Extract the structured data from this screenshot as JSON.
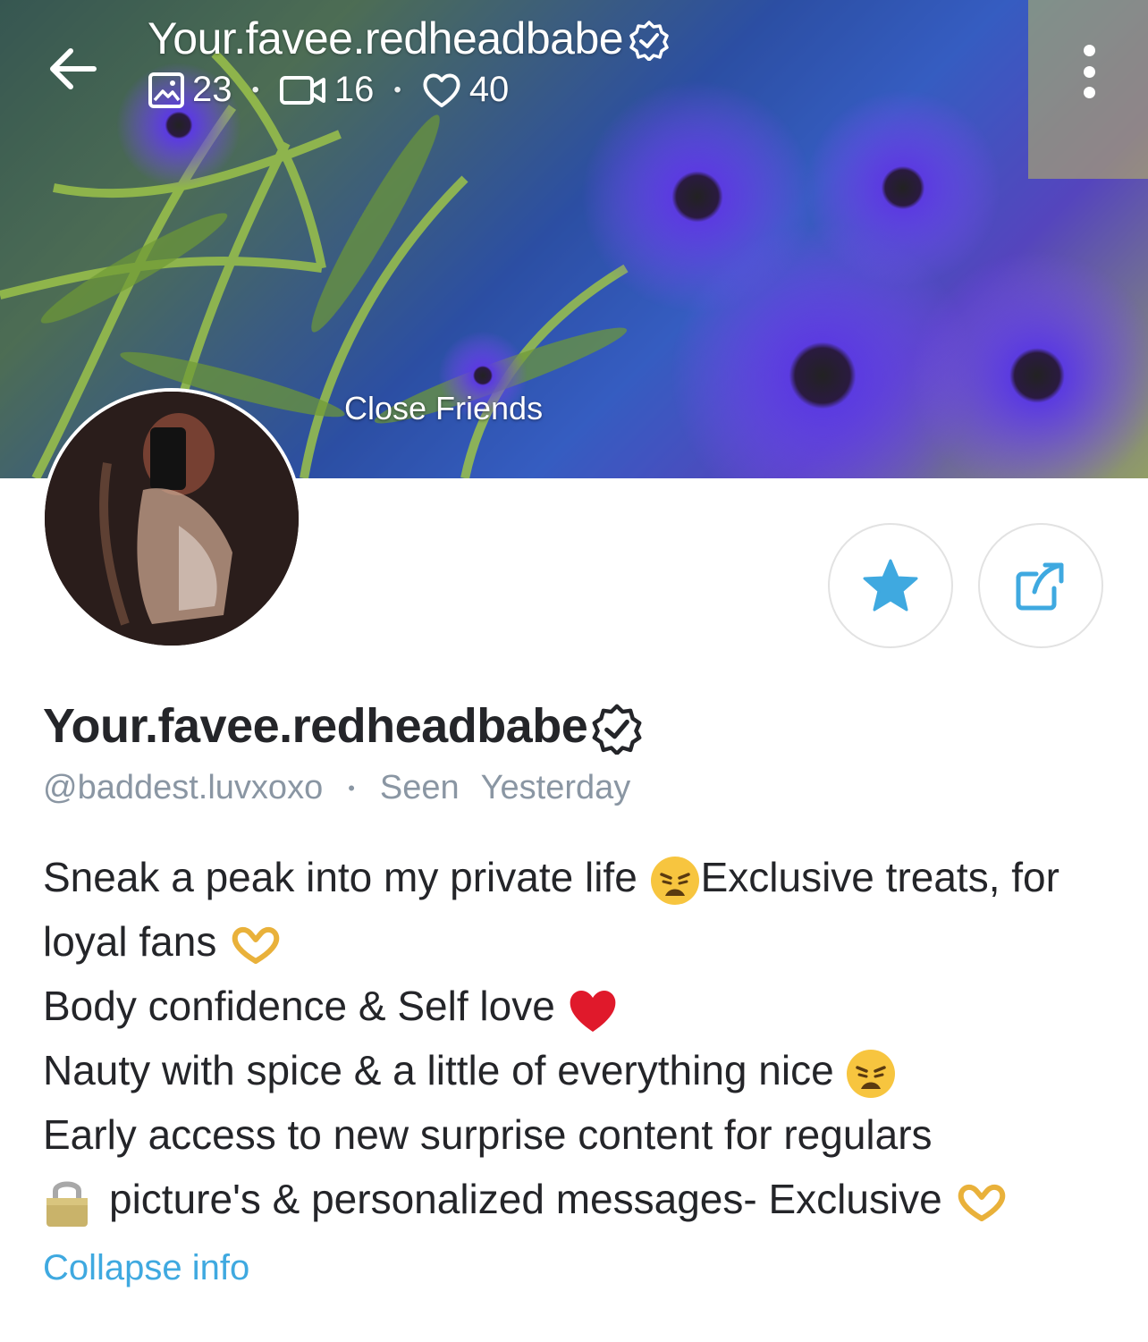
{
  "header": {
    "title": "Your.favee.redheadbabe",
    "stats": {
      "photos": "23",
      "videos": "16",
      "likes": "40"
    },
    "cover_label": "Close Friends"
  },
  "profile": {
    "name": "Your.favee.redheadbabe",
    "handle": "@baddest.luvxoxo",
    "seen_label": "Seen",
    "seen_value": "Yesterday"
  },
  "bio": {
    "line1_a": "Sneak a peak into my private life ",
    "line1_b": "Exclusive treats, for",
    "line2": "loyal fans ",
    "line3": "Body confidence & Self love ",
    "line4": "Nauty with spice & a little of everything nice ",
    "line5": "Early access to new surprise content for regulars",
    "line6": "picture's & personalized messages- Exclusive "
  },
  "links": {
    "collapse": "Collapse info"
  },
  "icons": {
    "back": "arrow-left-icon",
    "verified": "verified-badge-icon",
    "photos": "image-icon",
    "videos": "video-icon",
    "likes": "heart-icon",
    "more": "more-vertical-icon",
    "favorite": "star-icon",
    "share": "share-icon"
  },
  "colors": {
    "accent": "#3fa9e0",
    "muted": "#8a96a3",
    "text": "#242529"
  }
}
